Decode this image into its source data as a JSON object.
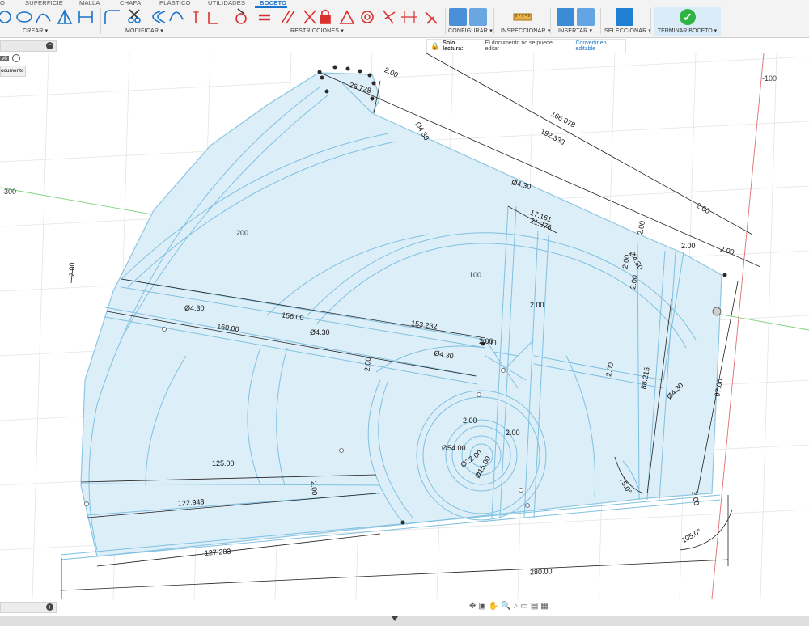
{
  "ribbon": {
    "tabs": [
      {
        "label": "O"
      },
      {
        "label": "SUPERFICIE"
      },
      {
        "label": "MALLA"
      },
      {
        "label": "CHAPA"
      },
      {
        "label": "PLÁSTICO"
      },
      {
        "label": "UTILIDADES"
      },
      {
        "label": "BOCETO"
      }
    ],
    "active_tab": "BOCETO",
    "groups": {
      "crear": "CREAR ▾",
      "modificar": "MODIFICAR ▾",
      "restricciones": "RESTRICCIONES ▾",
      "configurar": "CONFIGURAR ▾",
      "inspeccionar": "INSPECCIONAR ▾",
      "insertar": "INSERTAR ▾",
      "seleccionar": "SELECCIONAR ▾",
      "terminar": "TERMINAR BOCETO ▾"
    },
    "accent_color": "#1a73c8",
    "finish_color": "#2fb344"
  },
  "banner": {
    "title": "Solo lectura:",
    "message": "El documento no se puede editar",
    "link": "Convertir en editable"
  },
  "browser": {
    "item_tag": "v6",
    "doc_label": "ocumento"
  },
  "grid_labels": {
    "neg100": "-100",
    "g300": "300",
    "g200": "200",
    "g100": "100"
  },
  "dims": {
    "d2_top": "2.00",
    "d26": "26.728",
    "d166": "166.078",
    "d192": "192.333",
    "phi_a": "Ø4.30",
    "phi_b": "Ø4.30",
    "phi_c": "Ø4.30",
    "phi_d": "Ø4.30",
    "phi_e": "Ø4.30",
    "phi_f": "Ø4.30",
    "phi_g": "Ø4.30",
    "d17": "17.161",
    "d21": "21.376",
    "d2_a": "2.00",
    "d2_b": "2.00",
    "d2_c": "2.00",
    "d2_d": "2.00",
    "d2_e": "2.00",
    "d2_f": "2.00",
    "d2_g": "2.00",
    "d2_h": "2.00",
    "d2_i": "2.00",
    "d2_j": "2.00",
    "d2_k": "2.00",
    "d2_l": "2.00",
    "d2_m": "2.00",
    "d2_n": "2.00",
    "d156": "156.00",
    "d153": "153.232",
    "d160": "160.00",
    "d88": "88.215",
    "d97": "97.00",
    "d54": "Ø54.00",
    "d22": "Ø22.00",
    "d15": "Ø15.00",
    "d125": "125.00",
    "d122": "122.943",
    "d127": "127.283",
    "d280": "280.00",
    "a75": "75.0°",
    "a105": "105.0°",
    "d2_o": "2.00",
    "d2_p": "2.00"
  },
  "nav": {
    "icons": [
      "orbit-icon",
      "pan-icon",
      "zoom-icon",
      "fit-icon",
      "display-icon",
      "grid-icon",
      "viewports-icon"
    ]
  }
}
